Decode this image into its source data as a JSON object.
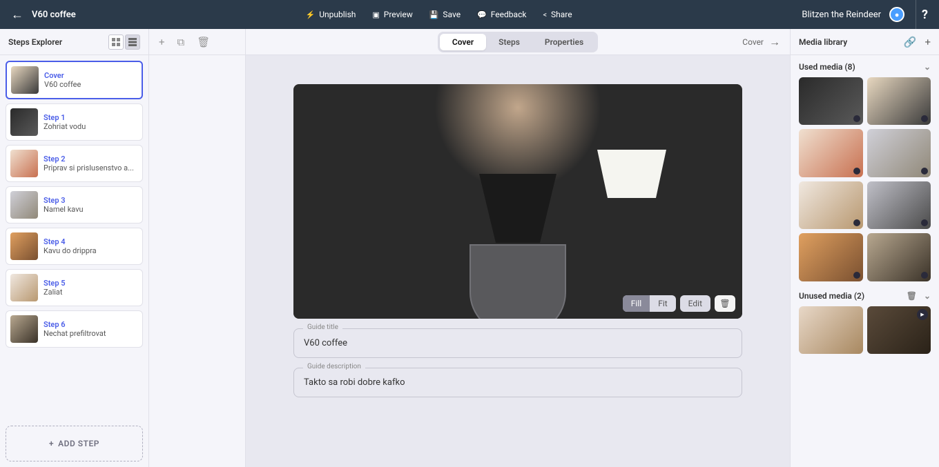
{
  "topbar": {
    "title": "V60 coffee",
    "unpublish": "Unpublish",
    "preview": "Preview",
    "save": "Save",
    "feedback": "Feedback",
    "share": "Share",
    "user": "Blitzen the Reindeer"
  },
  "steps_panel": {
    "title": "Steps Explorer",
    "add_step": "ADD STEP",
    "items": [
      {
        "label": "Cover",
        "desc": "V60 coffee"
      },
      {
        "label": "Step 1",
        "desc": "Zohriat vodu"
      },
      {
        "label": "Step 2",
        "desc": "Priprav si prislusenstvo a..."
      },
      {
        "label": "Step 3",
        "desc": "Namel kavu"
      },
      {
        "label": "Step 4",
        "desc": "Kavu do drippra"
      },
      {
        "label": "Step 5",
        "desc": "Zaliat"
      },
      {
        "label": "Step 6",
        "desc": "Nechat prefiltrovat"
      }
    ]
  },
  "canvas": {
    "tabs": {
      "cover": "Cover",
      "steps": "Steps",
      "properties": "Properties"
    },
    "nav_label": "Cover",
    "image_tools": {
      "fill": "Fill",
      "fit": "Fit",
      "edit": "Edit"
    },
    "guide_title_label": "Guide title",
    "guide_title_value": "V60 coffee",
    "guide_desc_label": "Guide description",
    "guide_desc_value": "Takto sa robi dobre kafko"
  },
  "media": {
    "title": "Media library",
    "used_label": "Used media (8)",
    "unused_label": "Unused media (2)"
  }
}
